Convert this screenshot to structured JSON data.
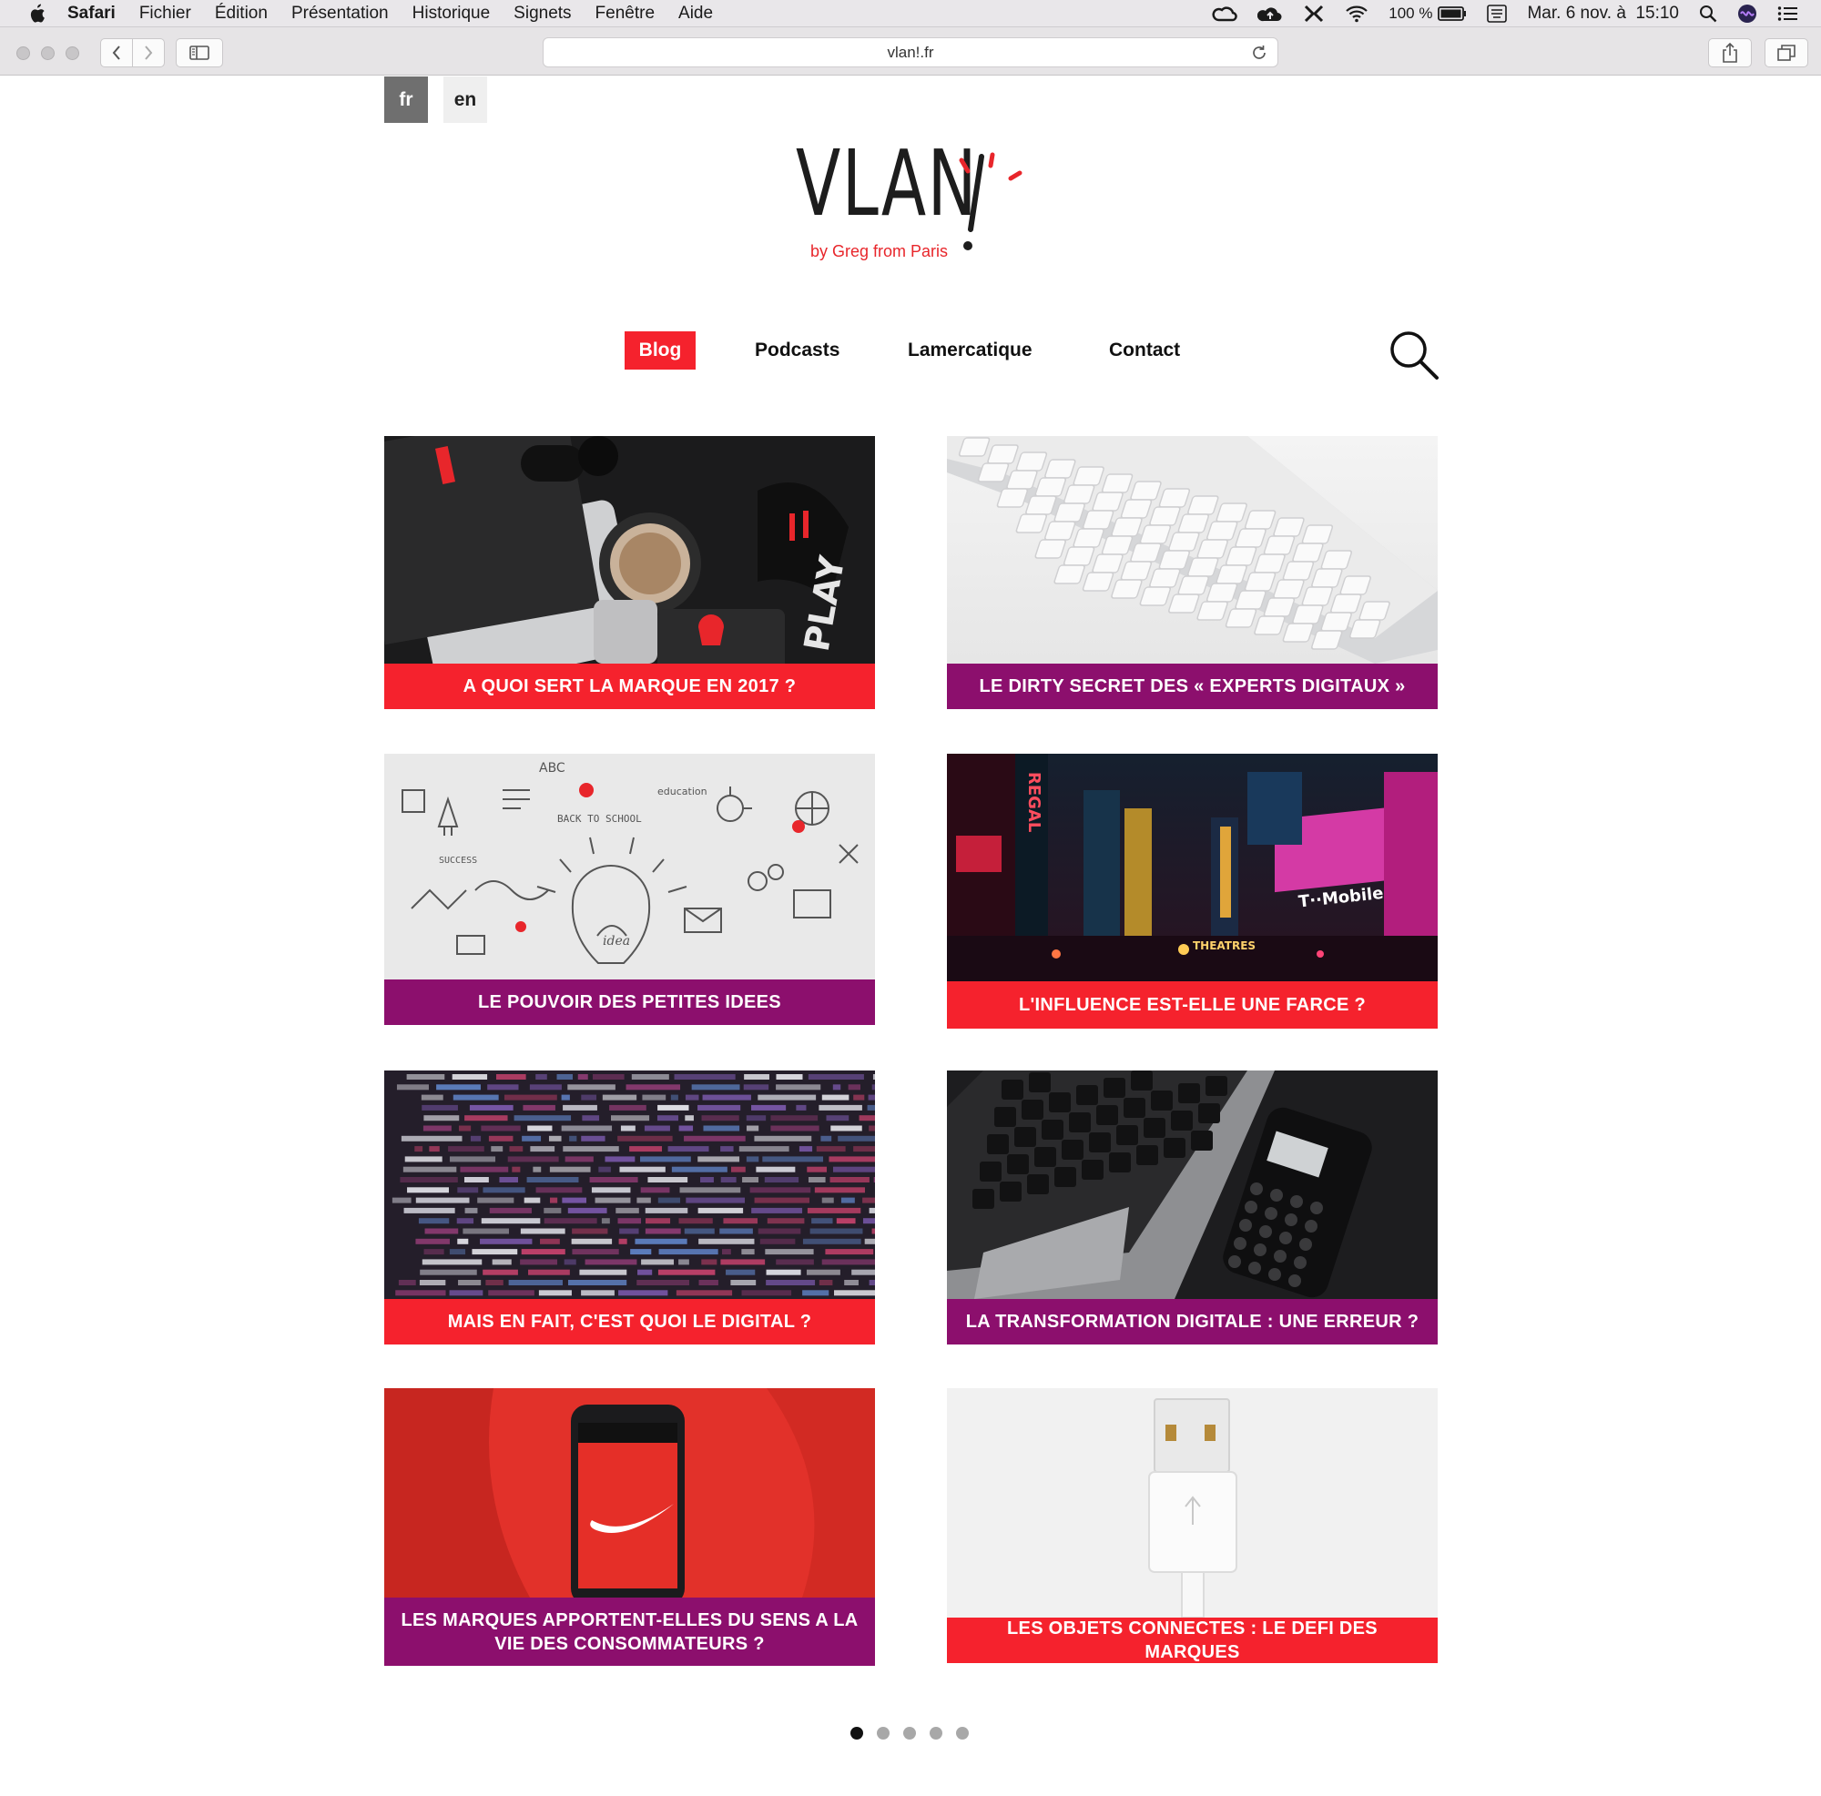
{
  "menubar": {
    "app": "Safari",
    "items": [
      "Fichier",
      "Édition",
      "Présentation",
      "Historique",
      "Signets",
      "Fenêtre",
      "Aide"
    ],
    "battery": "100 %",
    "datetime": "Mar. 6 nov. à  15:10"
  },
  "browser": {
    "url": "vlan!.fr"
  },
  "site": {
    "languages": [
      "fr",
      "en"
    ],
    "active_language": "fr",
    "logo_text": "VLAN",
    "logo_mark": "!",
    "tagline": "by Greg from Paris",
    "nav": [
      "Blog",
      "Podcasts",
      "Lamercatique",
      "Contact"
    ],
    "active_nav": "Blog",
    "accent_red": "#f5222d",
    "accent_purple": "#8c0f6d"
  },
  "articles": [
    {
      "title": "A QUOI SERT LA MARQUE EN 2017 ?",
      "color": "red",
      "image": "desk-headphones-coffee"
    },
    {
      "title": "LE DIRTY SECRET DES « EXPERTS DIGITAUX »",
      "color": "purple",
      "image": "white-keyboard"
    },
    {
      "title": "LE POUVOIR DES PETITES IDEES",
      "color": "purple",
      "image": "lightbulb-doodles"
    },
    {
      "title": "L'INFLUENCE EST-ELLE UNE FARCE ?",
      "color": "red",
      "image": "times-square-night"
    },
    {
      "title": "MAIS EN FAIT, C'EST QUOI LE DIGITAL ?",
      "color": "red",
      "image": "code-screen"
    },
    {
      "title": "LA TRANSFORMATION DIGITALE : UNE ERREUR ?",
      "color": "purple",
      "image": "laptop-calculator"
    },
    {
      "title": "LES MARQUES APPORTENT-ELLES DU SENS A LA VIE DES CONSOMMATEURS ?",
      "color": "purple",
      "image": "phone-nike-logo"
    },
    {
      "title": "LES OBJETS CONNECTES : LE DEFI DES MARQUES",
      "color": "red",
      "image": "usb-cable"
    }
  ],
  "pagination": {
    "pages": 5,
    "current": 1
  }
}
